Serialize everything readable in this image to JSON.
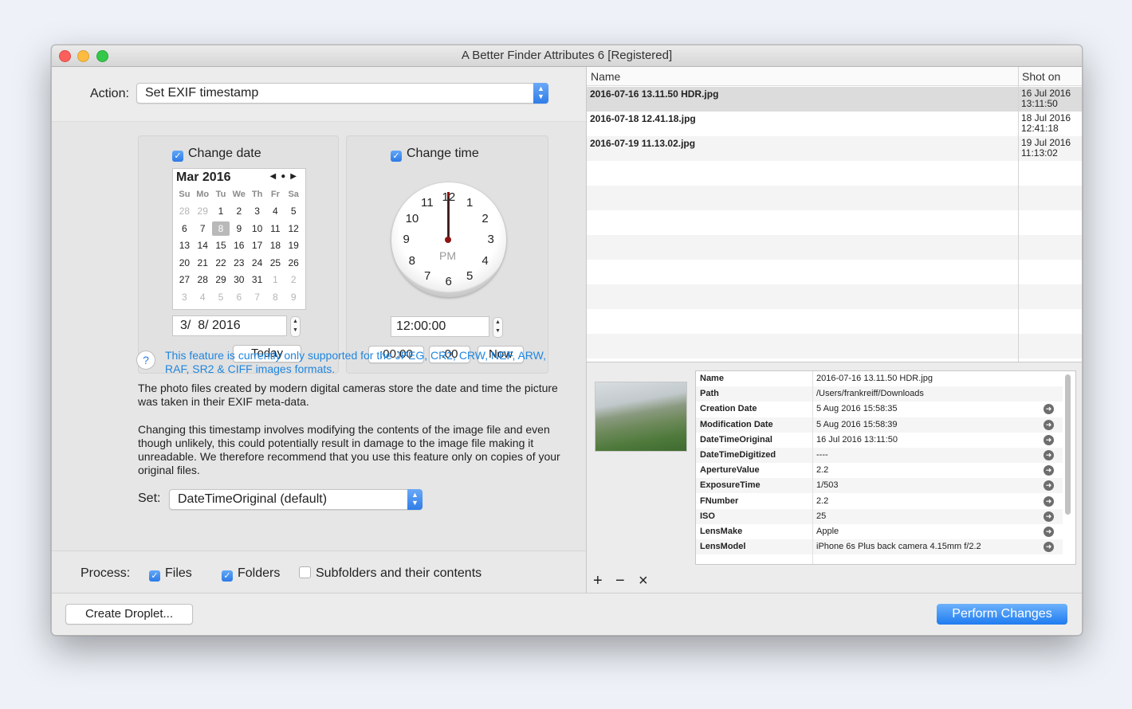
{
  "window": {
    "title": "A Better Finder Attributes 6 [Registered]"
  },
  "action": {
    "label": "Action:",
    "value": "Set EXIF timestamp"
  },
  "date_group": {
    "title": "Change date",
    "calendar": {
      "month": "Mar 2016",
      "dows": [
        "Su",
        "Mo",
        "Tu",
        "We",
        "Th",
        "Fr",
        "Sa"
      ],
      "days": [
        {
          "d": "28",
          "dim": true
        },
        {
          "d": "29",
          "dim": true
        },
        {
          "d": "1"
        },
        {
          "d": "2"
        },
        {
          "d": "3"
        },
        {
          "d": "4"
        },
        {
          "d": "5"
        },
        {
          "d": "6"
        },
        {
          "d": "7"
        },
        {
          "d": "8",
          "sel": true
        },
        {
          "d": "9"
        },
        {
          "d": "10"
        },
        {
          "d": "11"
        },
        {
          "d": "12"
        },
        {
          "d": "13"
        },
        {
          "d": "14"
        },
        {
          "d": "15"
        },
        {
          "d": "16"
        },
        {
          "d": "17"
        },
        {
          "d": "18"
        },
        {
          "d": "19"
        },
        {
          "d": "20"
        },
        {
          "d": "21"
        },
        {
          "d": "22"
        },
        {
          "d": "23"
        },
        {
          "d": "24"
        },
        {
          "d": "25"
        },
        {
          "d": "26"
        },
        {
          "d": "27"
        },
        {
          "d": "28"
        },
        {
          "d": "29"
        },
        {
          "d": "30"
        },
        {
          "d": "31"
        },
        {
          "d": "1",
          "dim": true
        },
        {
          "d": "2",
          "dim": true
        },
        {
          "d": "3",
          "dim": true
        },
        {
          "d": "4",
          "dim": true
        },
        {
          "d": "5",
          "dim": true
        },
        {
          "d": "6",
          "dim": true
        },
        {
          "d": "7",
          "dim": true
        },
        {
          "d": "8",
          "dim": true
        },
        {
          "d": "9",
          "dim": true
        }
      ]
    },
    "date_value": "3/  8/ 2016",
    "today_label": "Today"
  },
  "time_group": {
    "title": "Change time",
    "clock_numbers": [
      "12",
      "1",
      "2",
      "3",
      "4",
      "5",
      "6",
      "7",
      "8",
      "9",
      "10",
      "11"
    ],
    "meridiem": "PM",
    "time_value": "12:00:00",
    "btn_seconds": ":00:00",
    "btn_minutes": ":00",
    "btn_now": "Now"
  },
  "note": {
    "help": "?",
    "support": "This feature is currently only supported for the JPEG, CR2, CRW, NEF, ARW, RAF, SR2 & CIFF images formats.",
    "para1": "The photo files created by modern digital cameras store the date and time the picture was taken in their EXIF meta-data.",
    "para2": "Changing this timestamp involves modifying the contents of the image file and even though unlikely, this could potentially result in damage to the image file making it unreadable. We therefore recommend that you use this feature only on copies of your original files."
  },
  "set": {
    "label": "Set:",
    "value": "DateTimeOriginal (default)"
  },
  "process": {
    "label": "Process:",
    "files": "Files",
    "folders": "Folders",
    "subfolders": "Subfolders and their contents"
  },
  "buttons": {
    "create_droplet": "Create Droplet...",
    "perform": "Perform Changes"
  },
  "files_table": {
    "col_name": "Name",
    "col_shot": "Shot on",
    "rows": [
      {
        "name": "2016-07-16 13.11.50 HDR.jpg",
        "date": "16 Jul 2016",
        "time": "13:11:50"
      },
      {
        "name": "2016-07-18 12.41.18.jpg",
        "date": "18 Jul 2016",
        "time": "12:41:18"
      },
      {
        "name": "2016-07-19 11.13.02.jpg",
        "date": "19 Jul 2016",
        "time": "11:13:02"
      }
    ]
  },
  "metadata": [
    {
      "k": "Name",
      "v": "2016-07-16 13.11.50 HDR.jpg",
      "arrow": false
    },
    {
      "k": "Path",
      "v": "/Users/frankreiff/Downloads",
      "arrow": false
    },
    {
      "k": "Creation Date",
      "v": "5 Aug 2016 15:58:35",
      "arrow": true
    },
    {
      "k": "Modification Date",
      "v": "5 Aug 2016 15:58:39",
      "arrow": true
    },
    {
      "k": "DateTimeOriginal",
      "v": "16 Jul 2016 13:11:50",
      "arrow": true
    },
    {
      "k": "DateTimeDigitized",
      "v": "----",
      "arrow": true
    },
    {
      "k": "ApertureValue",
      "v": "2.2",
      "arrow": true
    },
    {
      "k": "ExposureTime",
      "v": "1/503",
      "arrow": true
    },
    {
      "k": "FNumber",
      "v": "2.2",
      "arrow": true
    },
    {
      "k": "ISO",
      "v": "25",
      "arrow": true
    },
    {
      "k": "LensMake",
      "v": "Apple",
      "arrow": true
    },
    {
      "k": "LensModel",
      "v": "iPhone 6s Plus back camera 4.15mm f/2.2",
      "arrow": true
    }
  ],
  "list_toolbar": {
    "add": "+",
    "remove": "−",
    "clear": "×"
  }
}
